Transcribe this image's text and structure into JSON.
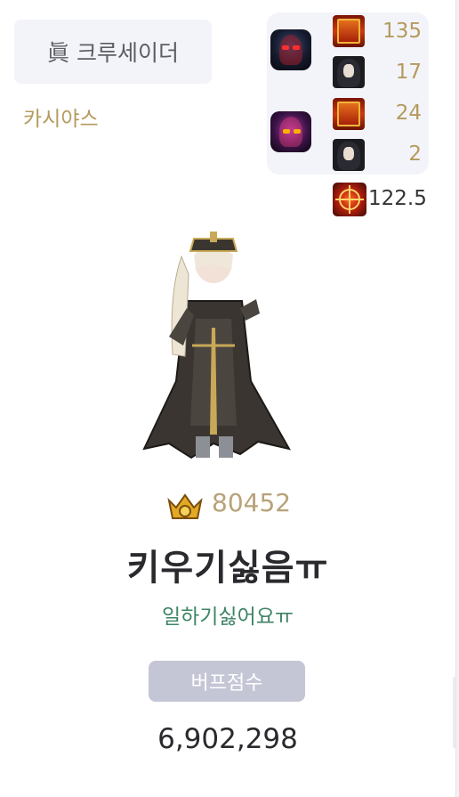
{
  "character_card": {
    "class_name": "眞 크루세이더",
    "server": "카시야스",
    "boss_stats": [
      {
        "boss_icon": "dark-knight-boss-icon",
        "rows": [
          {
            "icon": "item-drop-icon",
            "value": "135"
          },
          {
            "icon": "character-portrait-icon",
            "value": "17"
          }
        ]
      },
      {
        "boss_icon": "purple-demon-boss-icon",
        "rows": [
          {
            "icon": "item-drop-icon",
            "value": "24"
          },
          {
            "icon": "character-portrait-icon",
            "value": "2"
          }
        ]
      }
    ],
    "crit_icon": "crosshair-icon",
    "crit_value": "122.5",
    "fame_icon": "gold-emblem-icon",
    "fame": "80452",
    "name": "키우기싫음ㅠ",
    "guild": "일하기싫어요ㅠ",
    "buff_label": "버프점수",
    "buff_score": "6,902,298"
  },
  "colors": {
    "gold_text": "#b59a5e",
    "guild_green": "#3f8465",
    "badge_bg": "#f3f4f9",
    "buff_label_bg": "#c4c6d6"
  }
}
